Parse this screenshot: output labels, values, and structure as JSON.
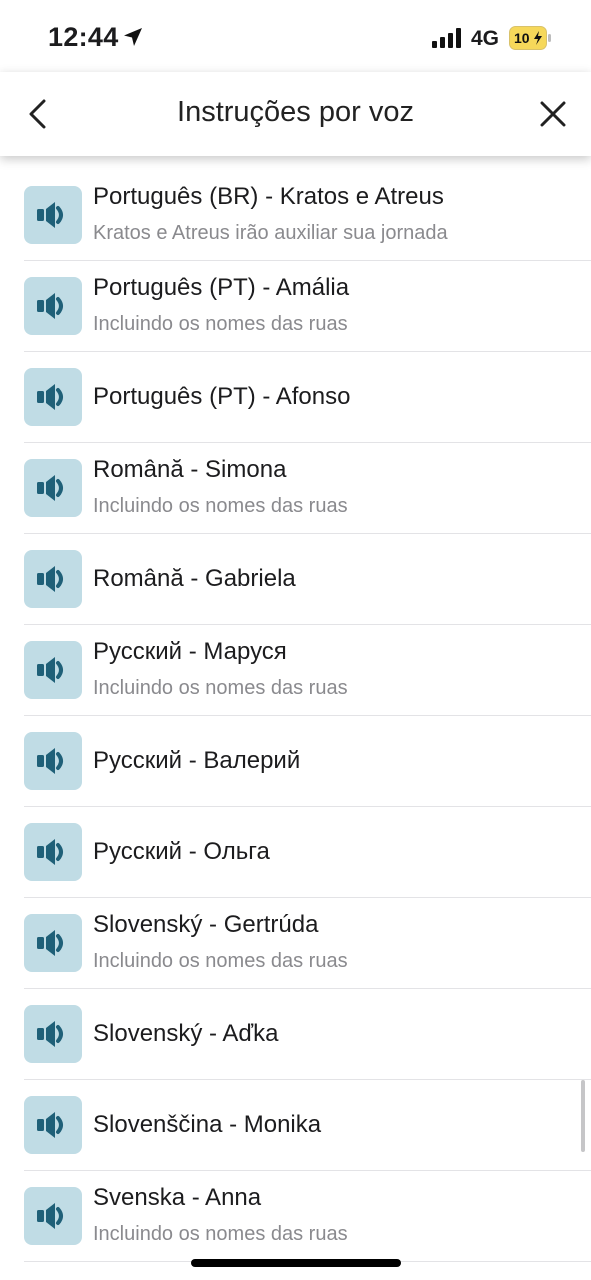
{
  "status_bar": {
    "time": "12:44",
    "network": "4G",
    "battery": "10"
  },
  "header": {
    "title": "Instruções por voz",
    "back_icon": "chevron-left-icon",
    "close_icon": "close-icon"
  },
  "voices": [
    {
      "title": "Português (BR) - Kratos e Atreus",
      "subtitle": "Kratos e Atreus irão auxiliar sua jornada"
    },
    {
      "title": "Português (PT) - Amália",
      "subtitle": "Incluindo os nomes das ruas"
    },
    {
      "title": "Português (PT) - Afonso"
    },
    {
      "title": "Română - Simona",
      "subtitle": "Incluindo os nomes das ruas"
    },
    {
      "title": "Română - Gabriela"
    },
    {
      "title": "Русский - Маруся",
      "subtitle": "Incluindo os nomes das ruas"
    },
    {
      "title": "Русский - Валерий"
    },
    {
      "title": "Русский - Ольга"
    },
    {
      "title": "Slovenský - Gertrúda",
      "subtitle": "Incluindo os nomes das ruas"
    },
    {
      "title": "Slovenský - Aďka"
    },
    {
      "title": "Slovenščina - Monika"
    },
    {
      "title": "Svenska - Anna",
      "subtitle": "Incluindo os nomes das ruas"
    }
  ],
  "colors": {
    "icon_bg": "#c0dce5",
    "icon_fg": "#1f6078",
    "battery_fill": "#f6d85a"
  }
}
